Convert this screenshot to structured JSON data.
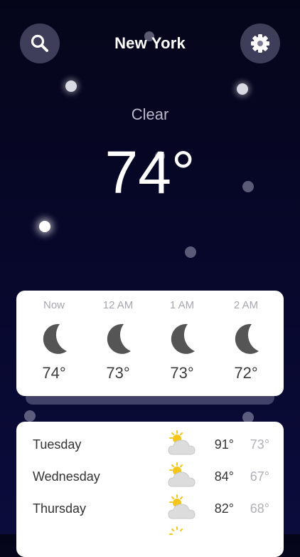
{
  "header": {
    "city": "New York",
    "search_icon": "search-icon",
    "settings_icon": "gear-icon"
  },
  "current": {
    "condition": "Clear",
    "temperature": "74°"
  },
  "hourly": [
    {
      "label": "Now",
      "icon": "moon-icon",
      "temp": "74°"
    },
    {
      "label": "12 AM",
      "icon": "moon-icon",
      "temp": "73°"
    },
    {
      "label": "1 AM",
      "icon": "moon-icon",
      "temp": "73°"
    },
    {
      "label": "2 AM",
      "icon": "moon-icon",
      "temp": "72°"
    }
  ],
  "daily": [
    {
      "day": "Tuesday",
      "icon": "partly-sunny-icon",
      "high": "91°",
      "low": "73°"
    },
    {
      "day": "Wednesday",
      "icon": "partly-sunny-icon",
      "high": "84°",
      "low": "67°"
    },
    {
      "day": "Thursday",
      "icon": "partly-sunny-icon",
      "high": "82°",
      "low": "68°"
    }
  ],
  "colors": {
    "background": "#07072a",
    "card": "#ffffff",
    "icon": "#555555",
    "sun": "#f5c518"
  }
}
